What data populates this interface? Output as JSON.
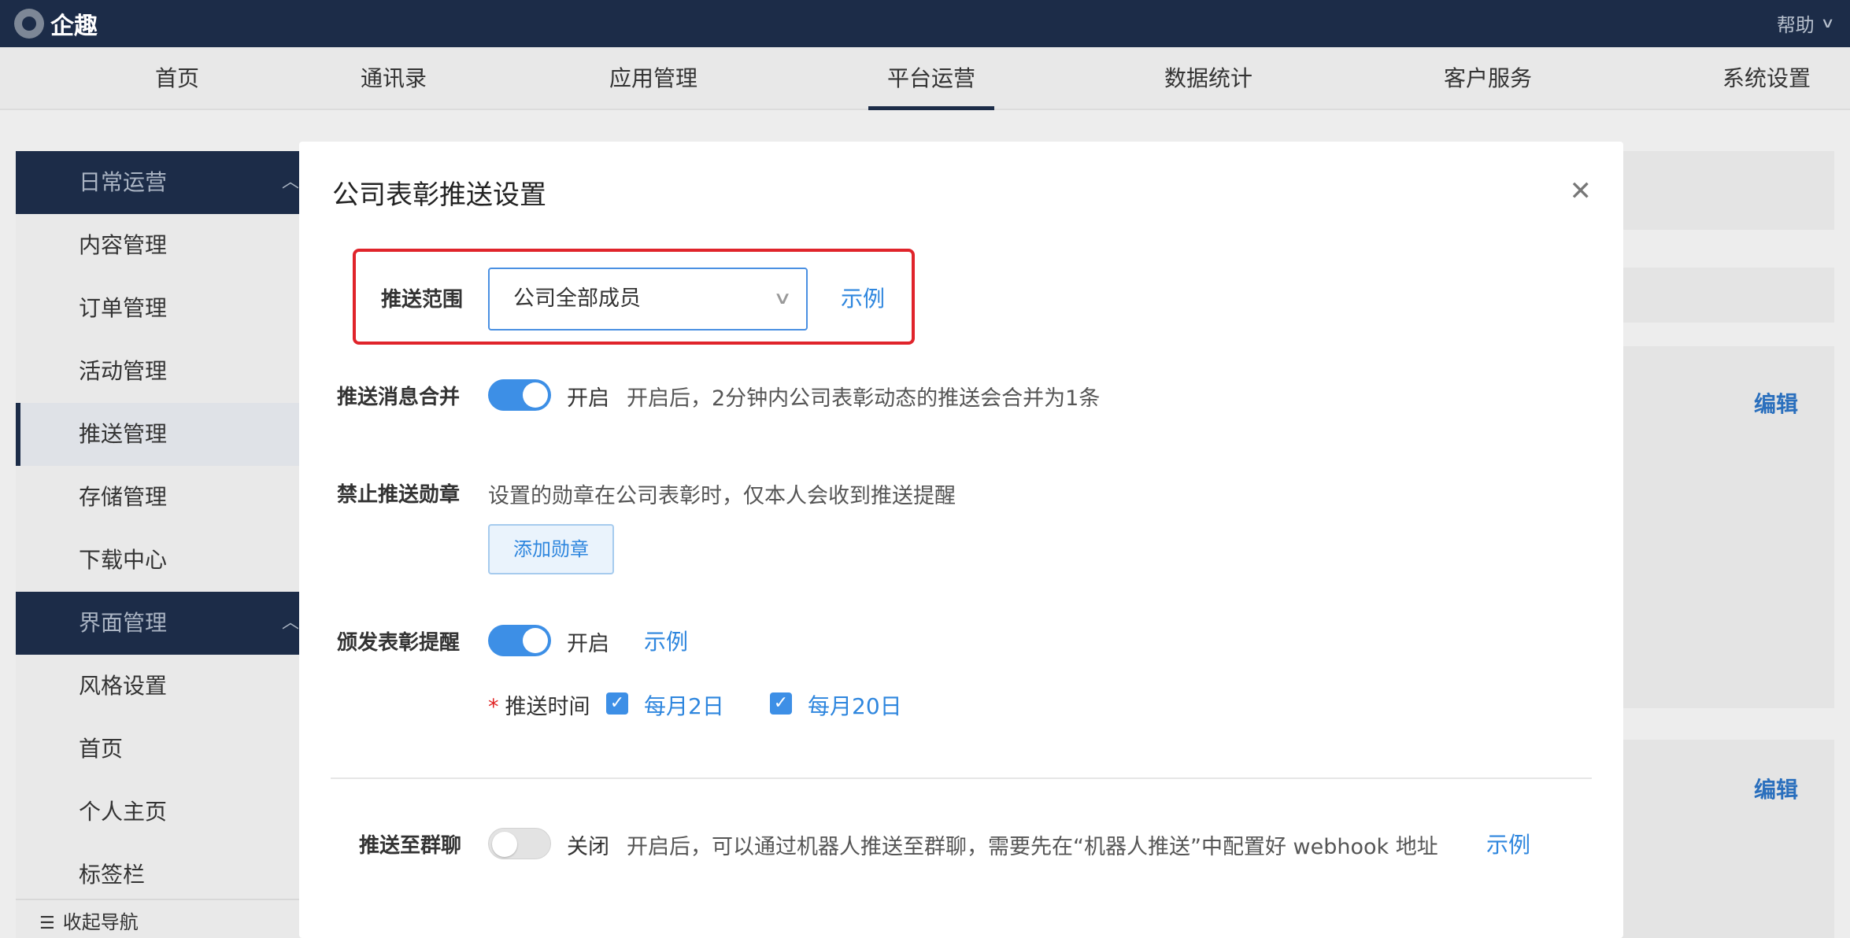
{
  "app": {
    "name": "企趣",
    "help_label": "帮助"
  },
  "nav": {
    "items": [
      {
        "label": "首页"
      },
      {
        "label": "通讯录"
      },
      {
        "label": "应用管理"
      },
      {
        "label": "平台运营",
        "active": true
      },
      {
        "label": "数据统计"
      },
      {
        "label": "客户服务"
      },
      {
        "label": "系统设置"
      }
    ]
  },
  "sidebar": {
    "group1": {
      "label": "日常运营"
    },
    "group1_items": [
      {
        "label": "内容管理"
      },
      {
        "label": "订单管理"
      },
      {
        "label": "活动管理"
      },
      {
        "label": "推送管理",
        "active": true
      },
      {
        "label": "存储管理"
      },
      {
        "label": "下载中心"
      }
    ],
    "group2": {
      "label": "界面管理"
    },
    "group2_items": [
      {
        "label": "风格设置"
      },
      {
        "label": "首页"
      },
      {
        "label": "个人主页"
      },
      {
        "label": "标签栏"
      }
    ],
    "collapse_label": "收起导航"
  },
  "background": {
    "edit_label": "编辑"
  },
  "modal": {
    "title": "公司表彰推送设置",
    "scope": {
      "label": "推送范围",
      "selected": "公司全部成员",
      "example_link": "示例"
    },
    "merge": {
      "label": "推送消息合并",
      "state_label": "开启",
      "enabled": true,
      "description": "开启后，2分钟内公司表彰动态的推送会合并为1条"
    },
    "forbid_medal": {
      "label": "禁止推送勋章",
      "description": "设置的勋章在公司表彰时，仅本人会收到推送提醒",
      "add_button": "添加勋章"
    },
    "award_reminder": {
      "label": "颁发表彰提醒",
      "state_label": "开启",
      "enabled": true,
      "example_link": "示例",
      "push_time_label": "推送时间",
      "options": [
        {
          "label": "每月2日",
          "checked": true
        },
        {
          "label": "每月20日",
          "checked": true
        }
      ]
    },
    "group_chat": {
      "label": "推送至群聊",
      "state_label": "关闭",
      "enabled": false,
      "description": "开启后，可以通过机器人推送至群聊，需要先在“机器人推送”中配置好 webhook 地址",
      "example_link": "示例"
    }
  },
  "colors": {
    "topbar": "#1c2c48",
    "accent": "#3d8fe6",
    "highlight": "#e0242b"
  }
}
